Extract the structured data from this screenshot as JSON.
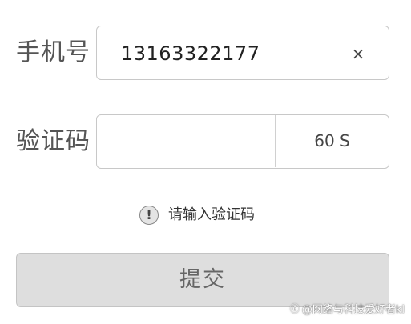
{
  "phone": {
    "label": "手机号",
    "value": "13163322177",
    "clear_icon": "×"
  },
  "code": {
    "label": "验证码",
    "value": "",
    "countdown": "60 S"
  },
  "hint": {
    "icon": "!",
    "text": "请输入验证码"
  },
  "submit": {
    "label": "提交"
  },
  "watermark": {
    "icon": "ⓒ",
    "text": "@网络与科技爱好者kl"
  },
  "colors": {
    "button_bg": "#dedede",
    "border": "#c8c8c8",
    "hint_icon_bg": "#e4e4e4"
  }
}
